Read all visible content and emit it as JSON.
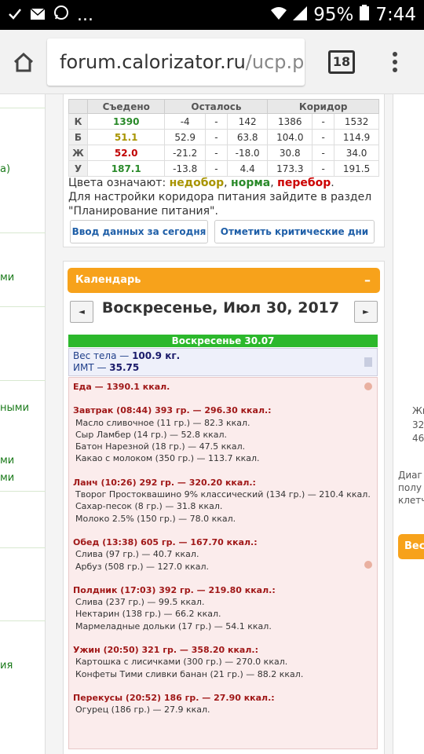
{
  "status": {
    "battery": "95%",
    "time": "7:44",
    "ellipsis": "..."
  },
  "browser": {
    "url_host": "forum.calorizator.ru",
    "url_path": "/ucp.php",
    "tab_count": "18"
  },
  "left_labels": [
    "a)",
    "ми",
    "ными",
    "ми",
    "ми",
    "ия"
  ],
  "right_labels": [
    "Жи",
    "32",
    "46",
    "Диаг",
    "полу",
    "клетч"
  ],
  "right_button": "Вес",
  "nutrition": {
    "headers": [
      "Съедено",
      "Осталось",
      "Коридор"
    ],
    "rows": [
      {
        "label": "К",
        "eaten": "1390",
        "eaten_color": "#2a8a2a",
        "rem_a": "-4",
        "rem_sep": "-",
        "rem_b": "142",
        "cor_a": "1386",
        "cor_sep": "-",
        "cor_b": "1532"
      },
      {
        "label": "Б",
        "eaten": "51.1",
        "eaten_color": "#a89400",
        "rem_a": "52.9",
        "rem_sep": "-",
        "rem_b": "63.8",
        "cor_a": "104.0",
        "cor_sep": "-",
        "cor_b": "114.9"
      },
      {
        "label": "Ж",
        "eaten": "52.0",
        "eaten_color": "#c00000",
        "rem_a": "-21.2",
        "rem_sep": "-",
        "rem_b": "-18.0",
        "cor_a": "30.8",
        "cor_sep": "-",
        "cor_b": "34.0"
      },
      {
        "label": "У",
        "eaten": "187.1",
        "eaten_color": "#2a8a2a",
        "rem_a": "-13.8",
        "rem_sep": "-",
        "rem_b": "4.4",
        "cor_a": "173.3",
        "cor_sep": "-",
        "cor_b": "191.5"
      }
    ],
    "legend_prefix": "Цвета означают: ",
    "legend_ned": "недобор",
    "legend_comma1": ", ",
    "legend_nor": "норма",
    "legend_comma2": ", ",
    "legend_per": "перебор",
    "legend_dot": ".",
    "note_line1": "Для настройки коридора питания зайдите в раздел",
    "note_line2": "\"Планирование питания\"."
  },
  "buttons": {
    "today": "Ввод данных за сегодня",
    "critical": "Отметить критические дни"
  },
  "calendar": {
    "title": "Календарь",
    "collapse": "–",
    "date": "Воскресенье, Июл 30, 2017",
    "prev": "◄",
    "next": "►",
    "day_bar": "Воскресенье 30.07",
    "weight_label": "Вес тела — ",
    "weight_value": "100.9 кг.",
    "bmi_label": "ИМТ — ",
    "bmi_value": "35.75"
  },
  "meals": {
    "total": "Еда — 1390.1 ккал.",
    "list": [
      {
        "header": "Завтрак (08:44) 393 гр. — 296.30 ккал.:",
        "items": [
          "Масло сливочное (11 гр.) — 82.3 ккал.",
          "Сыр Ламбер (14 гр.) — 52.8 ккал.",
          "Батон Нарезной (18 гр.) — 47.5 ккал.",
          "Какао с молоком (350 гр.) — 113.7 ккал."
        ]
      },
      {
        "header": "Ланч (10:26) 292 гр. — 320.20 ккал.:",
        "items": [
          "Творог Простоквашино 9% классический (134 гр.) — 210.4 ккал.",
          "Сахар-песок (8 гр.) — 31.8 ккал.",
          "Молоко 2.5% (150 гр.) — 78.0 ккал."
        ]
      },
      {
        "header": "Обед (13:38) 605 гр. — 167.70 ккал.:",
        "items": [
          "Слива (97 гр.) — 40.7 ккал.",
          "Арбуз (508 гр.) — 127.0 ккал."
        ]
      },
      {
        "header": "Полдник (17:03) 392 гр. — 219.80 ккал.:",
        "items": [
          "Слива (237 гр.) — 99.5 ккал.",
          "Нектарин (138 гр.) — 66.2 ккал.",
          "Мармеладные дольки (17 гр.) — 54.1 ккал."
        ]
      },
      {
        "header": "Ужин (20:50) 321 гр. — 358.20 ккал.:",
        "items": [
          "Картошка с лисичками (300 гр.) — 270.0 ккал.",
          "Конфеты Тими сливки банан (21 гр.) — 88.2 ккал."
        ]
      },
      {
        "header": "Перекусы (20:52) 186 гр. — 27.90 ккал.:",
        "items": [
          "Огурец (186 гр.) — 27.9 ккал."
        ]
      }
    ]
  }
}
